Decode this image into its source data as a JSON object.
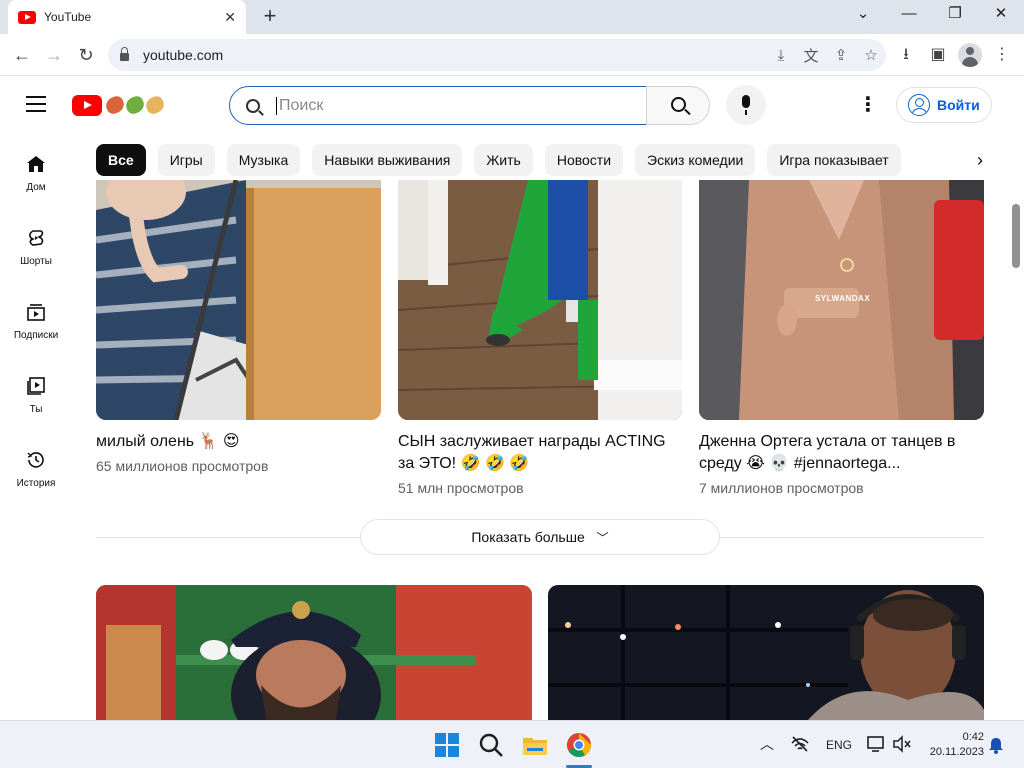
{
  "browser": {
    "tab_title": "YouTube",
    "url": "youtube.com"
  },
  "youtube": {
    "search_placeholder": "Поиск",
    "signin_label": "Войти",
    "chips": [
      "Все",
      "Игры",
      "Музыка",
      "Навыки выживания",
      "Жить",
      "Новости",
      "Эскиз комедии",
      "Игра показывает"
    ],
    "sidebar": [
      {
        "label": "Дом",
        "icon": "home-icon"
      },
      {
        "label": "Шорты",
        "icon": "shorts-icon"
      },
      {
        "label": "Подписки",
        "icon": "subscriptions-icon"
      },
      {
        "label": "Ты",
        "icon": "you-icon"
      },
      {
        "label": "История",
        "icon": "history-icon"
      }
    ],
    "shorts": [
      {
        "title": "милый олень 🦌 😍",
        "views": "65 миллионов просмотров"
      },
      {
        "title": "СЫН заслуживает награды ACTING за ЭТО! 🤣 🤣 🤣",
        "views": "51 млн просмотров"
      },
      {
        "title": "Дженна Ортега устала от танцев в среду 😭 💀 #jennaortega...",
        "views": "7 миллионов просмотров",
        "watermark": "SYLWANDAX"
      }
    ],
    "show_more_label": "Показать больше"
  },
  "taskbar": {
    "language": "ENG",
    "time": "0:42",
    "date": "20.11.2023"
  },
  "colors": {
    "youtube_red": "#ff0000",
    "link_blue": "#065fd4",
    "chip_bg": "#f2f2f2"
  }
}
